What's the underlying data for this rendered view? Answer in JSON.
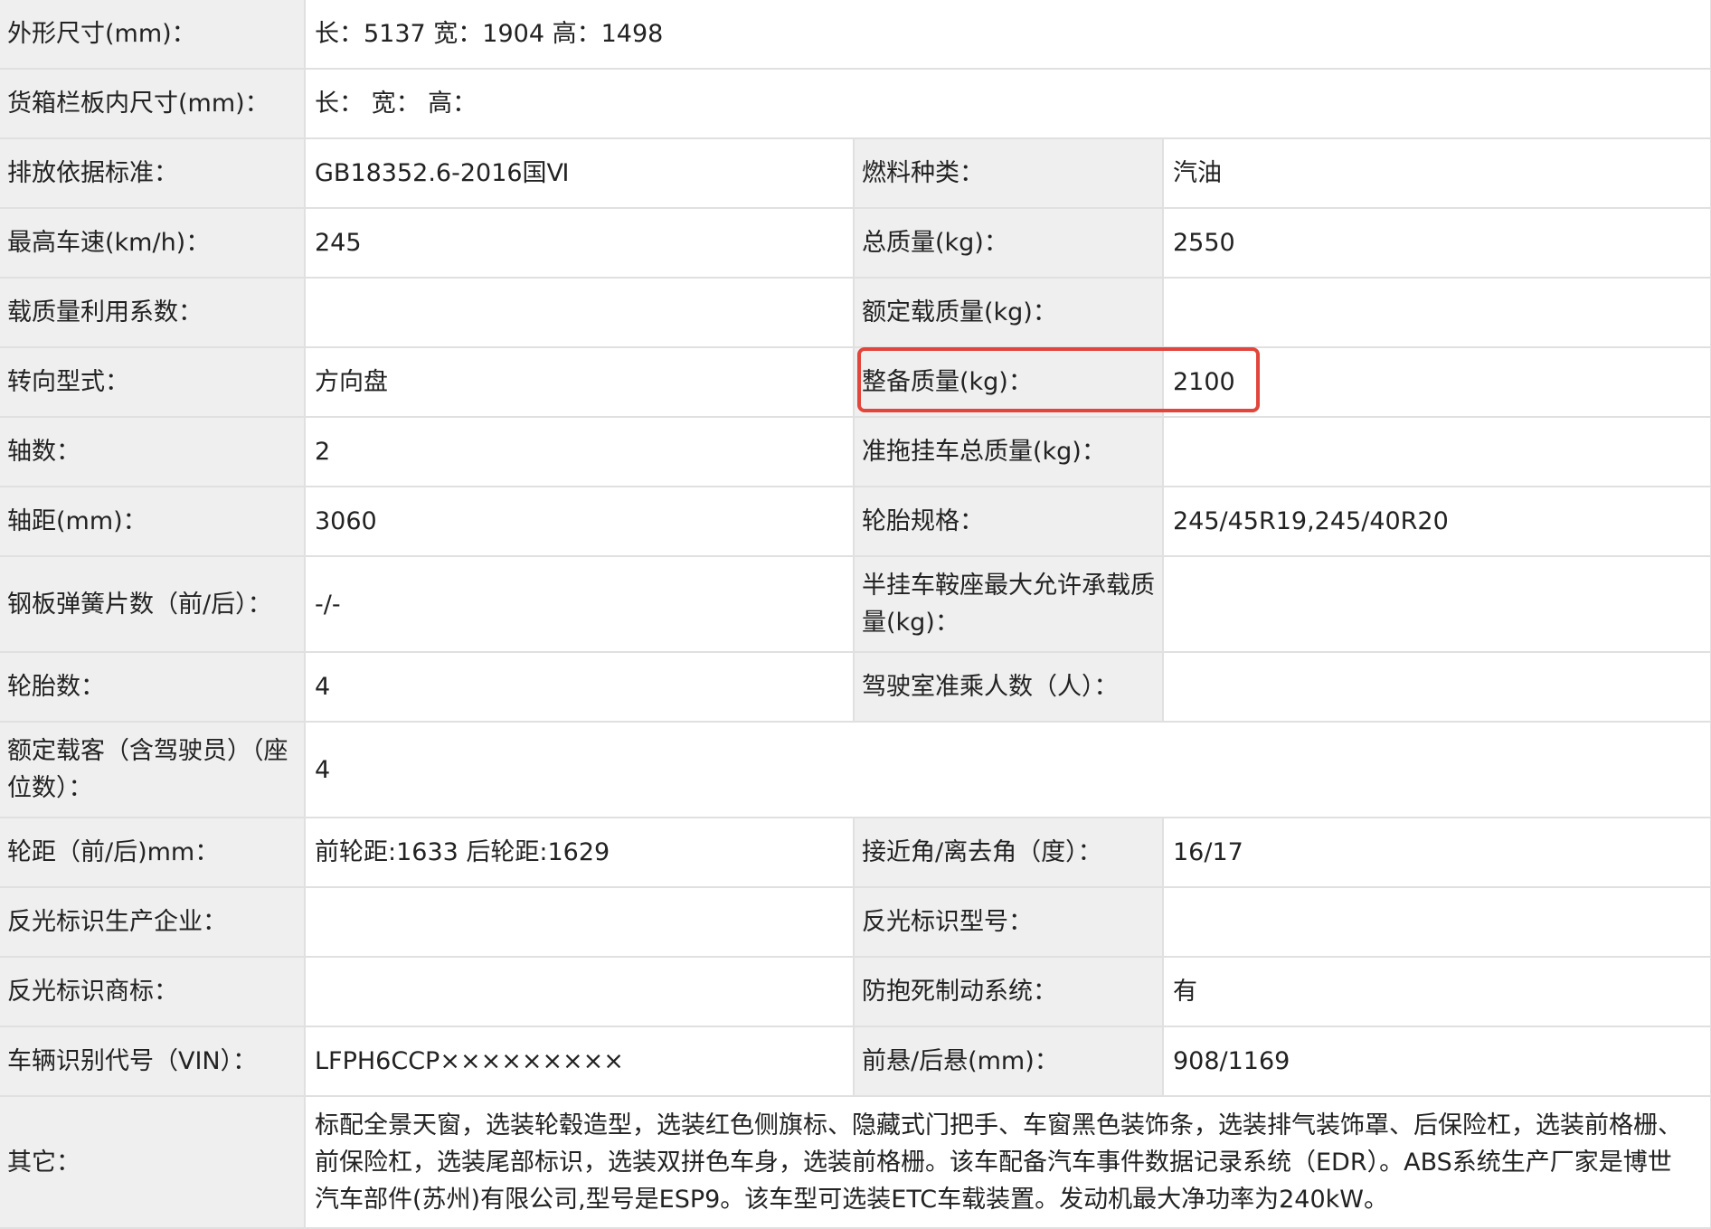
{
  "highlight_color": "#e2453b",
  "rows": {
    "dimensions": {
      "label": "外形尺寸(mm)：",
      "value": "长：5137 宽：1904 高：1498"
    },
    "cargo_box": {
      "label": "货箱栏板内尺寸(mm)：",
      "value": "长：  宽：  高："
    },
    "emission": {
      "label": "排放依据标准：",
      "value": "GB18352.6-2016国Ⅵ",
      "label2": "燃料种类：",
      "value2": "汽油"
    },
    "max_speed": {
      "label": "最高车速(km/h)：",
      "value": "245",
      "label2": "总质量(kg)：",
      "value2": "2550"
    },
    "load_factor": {
      "label": "载质量利用系数：",
      "value": "",
      "label2": "额定载质量(kg)：",
      "value2": ""
    },
    "steering": {
      "label": "转向型式：",
      "value": "方向盘",
      "label2": "整备质量(kg)：",
      "value2": "2100"
    },
    "axles": {
      "label": "轴数：",
      "value": "2",
      "label2": "准拖挂车总质量(kg)：",
      "value2": ""
    },
    "wheelbase": {
      "label": "轴距(mm)：",
      "value": "3060",
      "label2": "轮胎规格：",
      "value2": "245/45R19,245/40R20"
    },
    "springs": {
      "label": "钢板弹簧片数（前/后）：",
      "value": "-/-",
      "label2": "半挂车鞍座最大允许承载质量(kg)：",
      "value2": ""
    },
    "tires": {
      "label": "轮胎数：",
      "value": "4",
      "label2": "驾驶室准乘人数（人）：",
      "value2": ""
    },
    "passengers": {
      "label": "额定载客（含驾驶员）（座位数）：",
      "value": "4"
    },
    "track": {
      "label": "轮距（前/后)mm：",
      "value": "前轮距:1633 后轮距:1629",
      "label2": "接近角/离去角（度）：",
      "value2": "16/17"
    },
    "reflector_maker": {
      "label": "反光标识生产企业：",
      "value": "",
      "label2": "反光标识型号：",
      "value2": ""
    },
    "reflector_brand": {
      "label": "反光标识商标：",
      "value": "",
      "label2": "防抱死制动系统：",
      "value2": "有"
    },
    "vin": {
      "label": "车辆识别代号（VIN）：",
      "value": "LFPH6CCP×××××××××",
      "label2": "前悬/后悬(mm)：",
      "value2": "908/1169"
    },
    "other": {
      "label": "其它：",
      "value": "标配全景天窗，选装轮毂造型，选装红色侧旗标、隐藏式门把手、车窗黑色装饰条，选装排气装饰罩、后保险杠，选装前格栅、前保险杠，选装尾部标识，选装双拼色车身，选装前格栅。该车配备汽车事件数据记录系统（EDR）。ABS系统生产厂家是博世汽车部件(苏州)有限公司,型号是ESP9。该车型可选装ETC车载装置。发动机最大净功率为240kW。"
    }
  }
}
